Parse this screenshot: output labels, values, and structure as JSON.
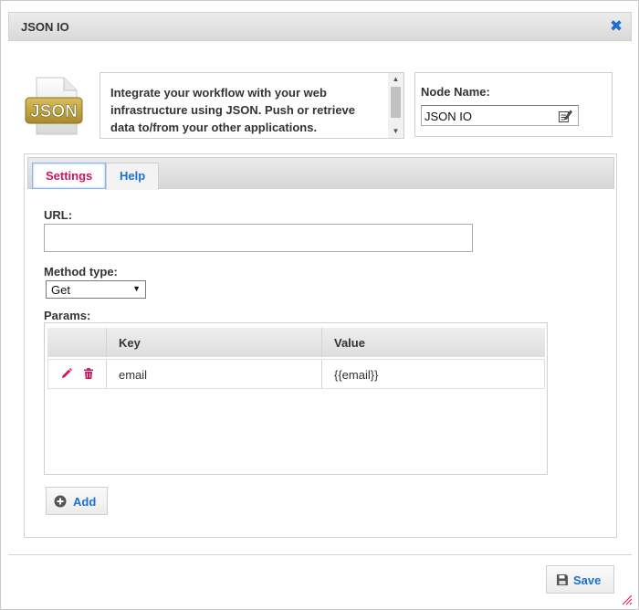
{
  "dialog": {
    "title": "JSON IO",
    "close_icon": "close-icon"
  },
  "header": {
    "logo_text": "JSON",
    "description": "Integrate your workflow with your web infrastructure using JSON. Push or retrieve data to/from your other applications.",
    "node_name_label": "Node Name:",
    "node_name_value": "JSON IO"
  },
  "tabs": [
    {
      "label": "Settings",
      "active": true
    },
    {
      "label": "Help",
      "active": false
    }
  ],
  "settings": {
    "url_label": "URL:",
    "url_value": "",
    "method_label": "Method type:",
    "method_value": "Get",
    "params_label": "Params:",
    "params_columns": [
      "",
      "Key",
      "Value"
    ],
    "params_rows": [
      {
        "key": "email",
        "value": "{{email}}"
      }
    ],
    "add_label": "Add"
  },
  "footer": {
    "save_label": "Save"
  },
  "colors": {
    "accent_blue": "#1a6fd0",
    "accent_pink": "#d4145a",
    "logo_gold": "#b89a3c"
  }
}
